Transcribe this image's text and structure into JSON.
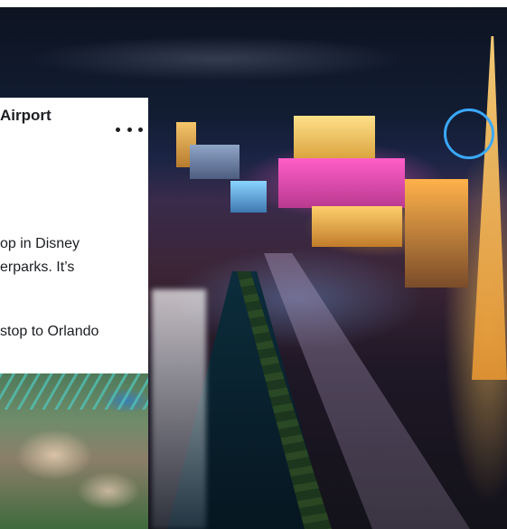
{
  "post": {
    "title_fragment": "Airport",
    "line1": "op in Disney",
    "line2": "erparks. It’s",
    "line3": "stop to Orlando"
  },
  "icons": {
    "more": "more-horizontal-icon"
  },
  "images": {
    "background": "las-vegas-strip-night-photo",
    "thumbnail": "theme-park-aerial-photo"
  }
}
